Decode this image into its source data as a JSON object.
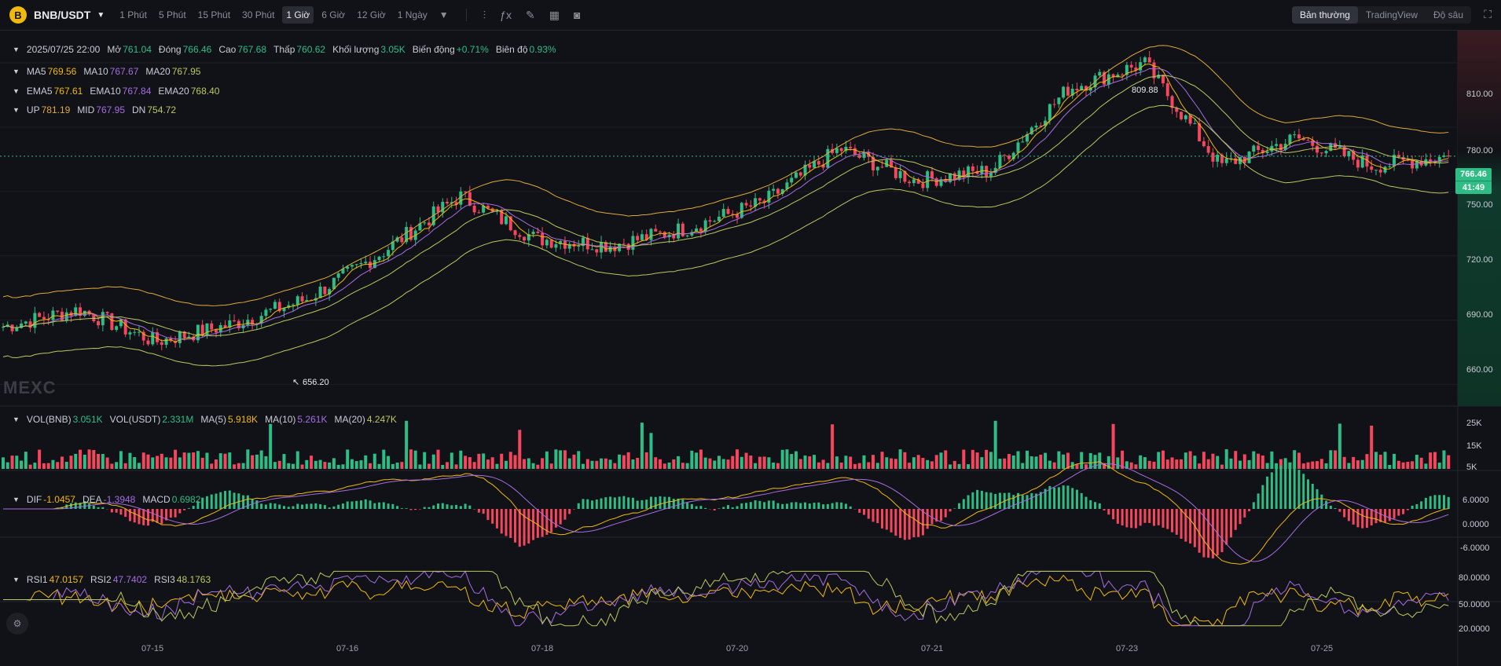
{
  "topbar": {
    "pair": "BNB/USDT",
    "timeframes": [
      "1 Phút",
      "5 Phút",
      "15 Phút",
      "30 Phút",
      "1 Giờ",
      "6 Giờ",
      "12 Giờ",
      "1 Ngày"
    ],
    "active_timeframe": "1 Giờ",
    "views": [
      "Bản thường",
      "TradingView",
      "Độ sâu"
    ],
    "active_view": "Bản thường"
  },
  "ohlc": {
    "date": "2025/07/25 22:00",
    "open_label": "Mở",
    "open": "761.04",
    "close_label": "Đóng",
    "close": "766.46",
    "high_label": "Cao",
    "high": "767.68",
    "low_label": "Thấp",
    "low": "760.62",
    "vol_label": "Khối lượng",
    "vol": "3.05K",
    "chg_label": "Biến động",
    "chg": "+0.71%",
    "amp_label": "Biên độ",
    "amp": "0.93%"
  },
  "ma": {
    "ma5_label": "MA5",
    "ma5": "769.56",
    "ma10_label": "MA10",
    "ma10": "767.67",
    "ma20_label": "MA20",
    "ma20": "767.95"
  },
  "ema": {
    "ema5_label": "EMA5",
    "ema5": "767.61",
    "ema10_label": "EMA10",
    "ema10": "767.84",
    "ema20_label": "EMA20",
    "ema20": "768.40"
  },
  "boll": {
    "up_label": "UP",
    "up": "781.19",
    "mid_label": "MID",
    "mid": "767.95",
    "dn_label": "DN",
    "dn": "754.72"
  },
  "price_axis": [
    "810.00",
    "780.00",
    "750.00",
    "720.00",
    "690.00",
    "660.00"
  ],
  "last_price": "766.46",
  "countdown": "41:49",
  "high_marker": "809.88",
  "low_marker": "656.20",
  "watermark": "MEXC",
  "vol": {
    "a_label": "VOL(BNB)",
    "a": "3.051K",
    "b_label": "VOL(USDT)",
    "b": "2.331M",
    "m5_label": "MA(5)",
    "m5": "5.918K",
    "m10_label": "MA(10)",
    "m10": "5.261K",
    "m20_label": "MA(20)",
    "m20": "4.247K"
  },
  "vol_axis": [
    "25K",
    "15K",
    "5K"
  ],
  "macd": {
    "dif_label": "DIF",
    "dif": "-1.0457",
    "dea_label": "DEA",
    "dea": "-1.3948",
    "macd_label": "MACD",
    "macd": "0.6982"
  },
  "macd_axis": [
    "6.0000",
    "0.0000",
    "-6.0000"
  ],
  "rsi": {
    "r1_label": "RSI1",
    "r1": "47.0157",
    "r2_label": "RSI2",
    "r2": "47.7402",
    "r3_label": "RSI3",
    "r3": "48.1763"
  },
  "rsi_axis": [
    "80.0000",
    "50.0000",
    "20.0000"
  ],
  "date_axis": [
    "07-15",
    "07-16",
    "07-18",
    "07-20",
    "07-21",
    "07-23",
    "07-25"
  ],
  "colors": {
    "up": "#2dbd85",
    "down": "#f6465d",
    "ma5": "#f0b90b",
    "ma10": "#a56de2",
    "ma20": "#b9c85f"
  },
  "chart_data": {
    "type": "candlestick",
    "interval": "1h",
    "price_range": [
      650,
      825
    ],
    "price_keypoints": [
      {
        "date": "07-14",
        "price": 687
      },
      {
        "date": "07-15",
        "price": 695
      },
      {
        "date": "07-15",
        "price": 680
      },
      {
        "date": "07-16",
        "price": 688
      },
      {
        "date": "07-16",
        "price": 700
      },
      {
        "date": "07-17",
        "price": 722
      },
      {
        "date": "07-18",
        "price": 748
      },
      {
        "date": "07-18",
        "price": 728
      },
      {
        "date": "07-19",
        "price": 725
      },
      {
        "date": "07-20",
        "price": 733
      },
      {
        "date": "07-20",
        "price": 745
      },
      {
        "date": "07-21",
        "price": 770
      },
      {
        "date": "07-21",
        "price": 755
      },
      {
        "date": "07-22",
        "price": 760
      },
      {
        "date": "07-23",
        "price": 798
      },
      {
        "date": "07-23",
        "price": 809.88
      },
      {
        "date": "07-24",
        "price": 762
      },
      {
        "date": "07-24",
        "price": 775
      },
      {
        "date": "07-25",
        "price": 762
      },
      {
        "date": "07-25",
        "price": 766.46
      }
    ],
    "high": 809.88,
    "low": 656.2
  }
}
